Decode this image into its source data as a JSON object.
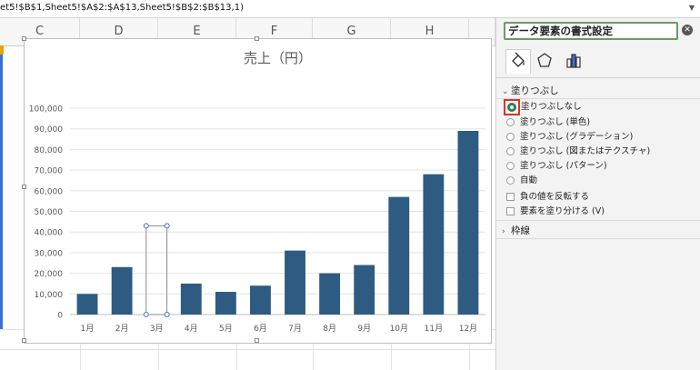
{
  "formula_bar": {
    "text": "et5!$B$1,Sheet5!$A$2:$A$13,Sheet5!$B$2:$B$13,1)"
  },
  "columns": [
    "C",
    "D",
    "E",
    "F",
    "G",
    "H"
  ],
  "chart_data": {
    "type": "bar",
    "title": "売上（円）",
    "categories": [
      "1月",
      "2月",
      "3月",
      "4月",
      "5月",
      "6月",
      "7月",
      "8月",
      "9月",
      "10月",
      "11月",
      "12月"
    ],
    "values": [
      10000,
      23000,
      0,
      15000,
      11000,
      14000,
      31000,
      20000,
      24000,
      57000,
      68000,
      89000
    ],
    "ylim": [
      0,
      100000
    ],
    "yticks": [
      "0",
      "10,000",
      "20,000",
      "30,000",
      "40,000",
      "50,000",
      "60,000",
      "70,000",
      "80,000",
      "90,000",
      "100,000"
    ],
    "bar_color": "#2e5b82",
    "selected_index": 2,
    "grid": true
  },
  "pane": {
    "title": "データ要素の書式設定",
    "fill_section": "塗りつぶし",
    "fill_options": [
      "塗りつぶしなし",
      "塗りつぶし (単色)",
      "塗りつぶし (グラデーション)",
      "塗りつぶし (図またはテクスチャ)",
      "塗りつぶし (パターン)",
      "自動"
    ],
    "checkboxes": [
      "負の値を反転する",
      "要素を塗り分ける (V)"
    ],
    "border_section": "枠線"
  },
  "colors": {
    "accent_green": "#2e7d5b",
    "highlight_red": "#e0321e"
  }
}
